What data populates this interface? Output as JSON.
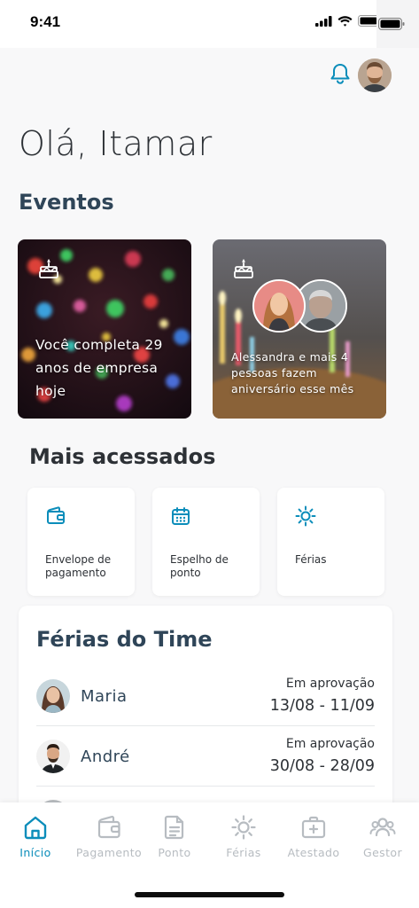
{
  "status_bar": {
    "time": "9:41"
  },
  "greeting": "Olá, Itamar",
  "events": {
    "title": "Eventos",
    "cards": [
      {
        "text": "Você completa 29 anos de empresa hoje"
      },
      {
        "text": "Alessandra e mais 4 pessoas fazem aniversário esse mês"
      }
    ]
  },
  "most_accessed": {
    "title": "Mais acessados",
    "items": [
      {
        "label": "Envelope de pagamento",
        "icon": "wallet-icon"
      },
      {
        "label": "Espelho de ponto",
        "icon": "calendar-icon"
      },
      {
        "label": "Férias",
        "icon": "sun-icon"
      }
    ]
  },
  "team_vacation": {
    "title": "Férias do Time",
    "rows": [
      {
        "name": "Maria",
        "status": "Em aprovação",
        "dates": "13/08 - 11/09"
      },
      {
        "name": "André",
        "status": "Em aprovação",
        "dates": "30/08 - 28/09"
      }
    ]
  },
  "bottom_nav": [
    {
      "label": "Início",
      "icon": "home-icon",
      "active": true
    },
    {
      "label": "Pagamento",
      "icon": "wallet-icon",
      "active": false
    },
    {
      "label": "Ponto",
      "icon": "document-icon",
      "active": false
    },
    {
      "label": "Férias",
      "icon": "sun-icon",
      "active": false
    },
    {
      "label": "Atestado",
      "icon": "medical-kit-icon",
      "active": false
    },
    {
      "label": "Gestor",
      "icon": "team-icon",
      "active": false
    }
  ],
  "colors": {
    "accent": "#0b8dba",
    "heading": "#2f4558",
    "inactive": "#b7bcc1",
    "background": "#f8f8f9"
  }
}
